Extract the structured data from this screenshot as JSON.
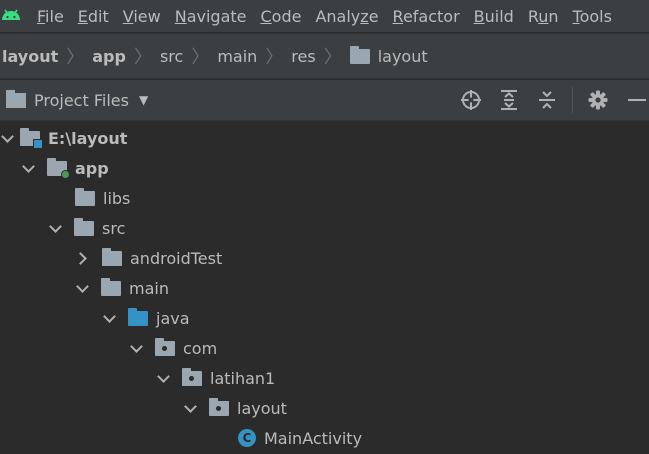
{
  "menubar": {
    "items": [
      {
        "label": "File",
        "mnemonic": "F"
      },
      {
        "label": "Edit",
        "mnemonic": "E"
      },
      {
        "label": "View",
        "mnemonic": "V"
      },
      {
        "label": "Navigate",
        "mnemonic": "N"
      },
      {
        "label": "Code",
        "mnemonic": "C"
      },
      {
        "label": "Analyze",
        "mnemonic": "z"
      },
      {
        "label": "Refactor",
        "mnemonic": "R"
      },
      {
        "label": "Build",
        "mnemonic": "B"
      },
      {
        "label": "Run",
        "mnemonic": "u"
      },
      {
        "label": "Tools",
        "mnemonic": "T"
      }
    ]
  },
  "breadcrumb": {
    "items": [
      "layout",
      "app",
      "src",
      "main",
      "res",
      "layout"
    ]
  },
  "toolbar": {
    "view_label": "Project Files"
  },
  "tree": {
    "nodes": [
      {
        "label": "E:\\layout",
        "icon": "folder-project-icon"
      },
      {
        "label": "app",
        "icon": "folder-module-icon"
      },
      {
        "label": "libs",
        "icon": "folder-icon"
      },
      {
        "label": "src",
        "icon": "folder-icon"
      },
      {
        "label": "androidTest",
        "icon": "folder-icon"
      },
      {
        "label": "main",
        "icon": "folder-icon"
      },
      {
        "label": "java",
        "icon": "source-folder-icon"
      },
      {
        "label": "com",
        "icon": "package-icon"
      },
      {
        "label": "latihan1",
        "icon": "package-icon"
      },
      {
        "label": "layout",
        "icon": "package-icon"
      },
      {
        "label": "MainActivity",
        "icon": "class-icon"
      }
    ]
  },
  "colors": {
    "background": "#2b2b2b",
    "panel": "#3c3f41",
    "text": "#bbbbbb",
    "folder": "#9aa7b0",
    "source_folder": "#3592c4",
    "module_dot": "#499c54",
    "android": "#3ddc84"
  }
}
